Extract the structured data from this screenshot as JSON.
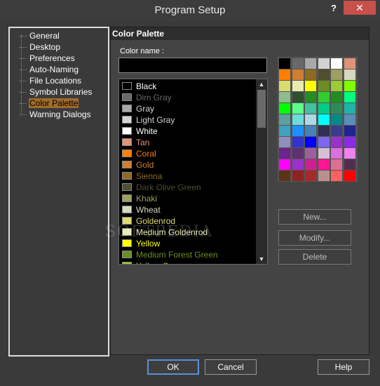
{
  "window": {
    "title": "Program Setup",
    "help_glyph": "?",
    "close_glyph": "✕"
  },
  "tree": {
    "items": [
      {
        "label": "General"
      },
      {
        "label": "Desktop"
      },
      {
        "label": "Preferences"
      },
      {
        "label": "Auto-Naming"
      },
      {
        "label": "File Locations"
      },
      {
        "label": "Symbol Libraries"
      },
      {
        "label": "Color Palette",
        "selected": true
      },
      {
        "label": "Warning Dialogs"
      }
    ]
  },
  "panel": {
    "title": "Color Palette",
    "color_name_label": "Color name :",
    "color_name_value": "",
    "colors": [
      {
        "name": "Black",
        "swatch": "#000000",
        "text": "#ffffff"
      },
      {
        "name": "Dim Gray",
        "swatch": "#696969",
        "text": "#696969"
      },
      {
        "name": "Gray",
        "swatch": "#a9a9a9",
        "text": "#d8d8d8"
      },
      {
        "name": "Light Gray",
        "swatch": "#d3d3d3",
        "text": "#d3d3d3"
      },
      {
        "name": "White",
        "swatch": "#ffffff",
        "text": "#ffffff"
      },
      {
        "name": "Tan",
        "swatch": "#e0937a",
        "text": "#e0937a"
      },
      {
        "name": "Coral",
        "swatch": "#ff7f00",
        "text": "#ff7f00"
      },
      {
        "name": "Gold",
        "swatch": "#cd7f32",
        "text": "#cd7f32"
      },
      {
        "name": "Sienna",
        "swatch": "#8e6b23",
        "text": "#8e6b23"
      },
      {
        "name": "Dark Olive Green",
        "swatch": "#4f4f2f",
        "text": "#4f4f2f"
      },
      {
        "name": "Khaki",
        "swatch": "#9f9f5f",
        "text": "#9f9f5f"
      },
      {
        "name": "Wheat",
        "swatch": "#d8d8bf",
        "text": "#d8d8bf"
      },
      {
        "name": "Goldenrod",
        "swatch": "#dbdb70",
        "text": "#dbdb70"
      },
      {
        "name": "Medium Goldenrod",
        "swatch": "#eaeaae",
        "text": "#eaeaae"
      },
      {
        "name": "Yellow",
        "swatch": "#ffff00",
        "text": "#ffff00"
      },
      {
        "name": "Medium Forest Green",
        "swatch": "#6b8e23",
        "text": "#6b8e23"
      },
      {
        "name": "Yellow Green",
        "swatch": "#99cc32",
        "text": "#99cc32"
      }
    ],
    "grid": [
      "#000000",
      "#696969",
      "#a9a9a9",
      "#d3d3d3",
      "#ffffff",
      "#e0937a",
      "#ff7f00",
      "#cd7f32",
      "#8e6b23",
      "#4f4f2f",
      "#9f9f5f",
      "#d8d8bf",
      "#dbdb70",
      "#eaeaae",
      "#ffff00",
      "#6b8e23",
      "#99cc32",
      "#7fff00",
      "#8fbc8f",
      "#2f4f2f",
      "#238e23",
      "#32cd32",
      "#228b22",
      "#00ff7f",
      "#00ff00",
      "#5cff8a",
      "#42c0a0",
      "#00cc88",
      "#2e8b57",
      "#20b2aa",
      "#5f9f9f",
      "#70dbdb",
      "#add8e6",
      "#00ffff",
      "#008b8b",
      "#5a8fb8",
      "#3fa0c0",
      "#1e90ff",
      "#4682b4",
      "#2f2f4f",
      "#3b3b8f",
      "#23238e",
      "#8f8fbd",
      "#3232cd",
      "#0000ff",
      "#7b68ee",
      "#9932cd",
      "#8a2be2",
      "#6b238e",
      "#5f2f6f",
      "#9f5f9f",
      "#d8bfd8",
      "#db70db",
      "#ee82ee",
      "#ff00ff",
      "#9932cc",
      "#d02090",
      "#ff1493",
      "#db7093",
      "#4f2f4f",
      "#5c3317",
      "#8e2323",
      "#a62a2a",
      "#bc8f8f",
      "#ff6060",
      "#ff0000"
    ],
    "buttons": {
      "new": "New...",
      "modify": "Modify...",
      "delete": "Delete"
    }
  },
  "footer": {
    "ok": "OK",
    "cancel": "Cancel",
    "help": "Help"
  },
  "watermark": "SOFTPEDIA"
}
